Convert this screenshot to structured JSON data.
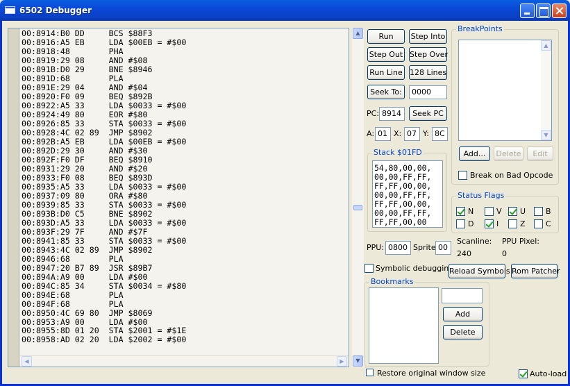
{
  "window": {
    "title": "6502 Debugger"
  },
  "disassembly": [
    "00:8914:B0 DD     BCS $88F3",
    "00:8916:A5 EB     LDA $00EB = #$00",
    "00:8918:48        PHA",
    "00:8919:29 08     AND #$08",
    "00:891B:D0 29     BNE $8946",
    "00:891D:68        PLA",
    "00:891E:29 04     AND #$04",
    "00:8920:F0 09     BEQ $892B",
    "00:8922:A5 33     LDA $0033 = #$00",
    "00:8924:49 80     EOR #$80",
    "00:8926:85 33     STA $0033 = #$00",
    "00:8928:4C 02 89  JMP $8902",
    "00:892B:A5 EB     LDA $00EB = #$00",
    "00:892D:29 30     AND #$30",
    "00:892F:F0 DF     BEQ $8910",
    "00:8931:29 20     AND #$20",
    "00:8933:F0 08     BEQ $893D",
    "00:8935:A5 33     LDA $0033 = #$00",
    "00:8937:09 80     ORA #$80",
    "00:8939:85 33     STA $0033 = #$00",
    "00:893B:D0 C5     BNE $8902",
    "00:893D:A5 33     LDA $0033 = #$00",
    "00:893F:29 7F     AND #$7F",
    "00:8941:85 33     STA $0033 = #$00",
    "00:8943:4C 02 89  JMP $8902",
    "00:8946:68        PLA",
    "00:8947:20 B7 89  JSR $89B7",
    "00:894A:A9 00     LDA #$00",
    "00:894C:85 34     STA $0034 = #$80",
    "00:894E:68        PLA",
    "00:894F:68        PLA",
    "00:8950:4C 69 80  JMP $8069",
    "00:8953:A9 00     LDA #$00",
    "00:8955:8D 01 20  STA $2001 = #$1E",
    "00:8958:AD 02 20  LDA $2002 = #$00"
  ],
  "controls": {
    "run": "Run",
    "step_into": "Step Into",
    "step_out": "Step Out",
    "step_over": "Step Over",
    "run_line": "Run Line",
    "lines_128": "128 Lines",
    "seek_to": "Seek To:",
    "seek_to_value": "0000",
    "pc_label": "PC:",
    "pc_value": "8914",
    "seek_pc": "Seek PC",
    "a_label": "A:",
    "a_value": "01",
    "x_label": "X:",
    "x_value": "07",
    "y_label": "Y:",
    "y_value": "8C"
  },
  "stack": {
    "title": "Stack $01FD",
    "lines": [
      "54,80,00,00,",
      "00,00,FF,FF,",
      "FF,FF,00,00,",
      "00,00,FF,FF,",
      "FF,FF,00,00,",
      "00,00,FF,FF,",
      "FF,FF,00,00"
    ]
  },
  "breakpoints": {
    "title": "BreakPoints",
    "add": "Add...",
    "delete": "Delete",
    "edit": "Edit",
    "break_bad_opcode": "Break on Bad Opcode"
  },
  "status_flags": {
    "title": "Status Flags",
    "flags": [
      {
        "label": "N",
        "checked": true
      },
      {
        "label": "V",
        "checked": false
      },
      {
        "label": "U",
        "checked": true
      },
      {
        "label": "B",
        "checked": false
      },
      {
        "label": "D",
        "checked": false
      },
      {
        "label": "I",
        "checked": true
      },
      {
        "label": "Z",
        "checked": false
      },
      {
        "label": "C",
        "checked": false
      }
    ]
  },
  "ppu": {
    "ppu_label": "PPU:",
    "ppu_value": "0800",
    "sprite_label": "Sprite:",
    "sprite_value": "00",
    "scanline_label": "Scanline:",
    "scanline_value": "240",
    "pixel_label": "PPU Pixel:",
    "pixel_value": "0"
  },
  "symbolic": {
    "label": "Symbolic debugging",
    "reload": "Reload Symbols",
    "rom_patcher": "Rom Patcher"
  },
  "bookmarks": {
    "title": "Bookmarks",
    "add": "Add",
    "delete": "Delete"
  },
  "footer": {
    "restore": "Restore original window size",
    "autoload": "Auto-load"
  }
}
